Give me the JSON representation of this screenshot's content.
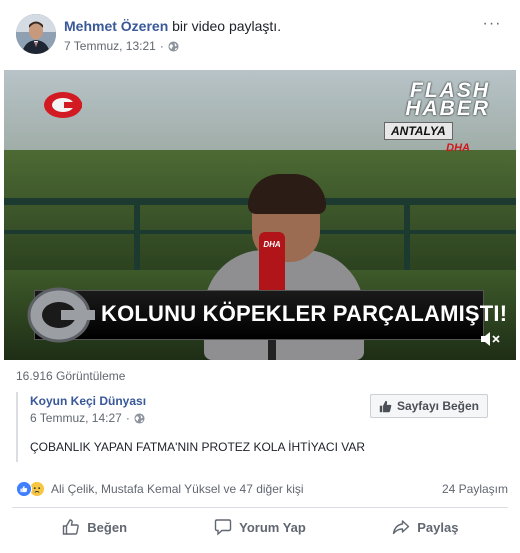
{
  "post": {
    "author_name": "Mehmet Özeren",
    "action_text": "bir video paylaştı.",
    "timestamp": "7 Temmuz, 13:21",
    "more_label": "···"
  },
  "video": {
    "overlay_title_line1": "FLASH",
    "overlay_title_line2": "HABER",
    "overlay_city": "ANTALYA",
    "overlay_agency": "DHA",
    "mic_label": "DHA",
    "ticker_text": "KOLUNU KÖPEKLER PARÇALAMIŞTI!"
  },
  "views": "16.916 Görüntüleme",
  "shared_page": {
    "name": "Koyun Keçi Dünyası",
    "timestamp": "6 Temmuz, 14:27",
    "like_button_label": "Sayfayı Beğen",
    "caption": "ÇOBANLIK YAPAN FATMA'NIN PROTEZ KOLA İHTİYACI VAR"
  },
  "reactions": {
    "names_text": "Ali Çelik, Mustafa Kemal Yüksel ve 47 diğer kişi",
    "shares_text": "24 Paylaşım"
  },
  "actions": {
    "like": "Beğen",
    "comment": "Yorum Yap",
    "share": "Paylaş"
  },
  "colors": {
    "link": "#385898",
    "meta": "#616770",
    "like_reaction": "#4080ff",
    "sad_reaction": "#f7c744"
  }
}
